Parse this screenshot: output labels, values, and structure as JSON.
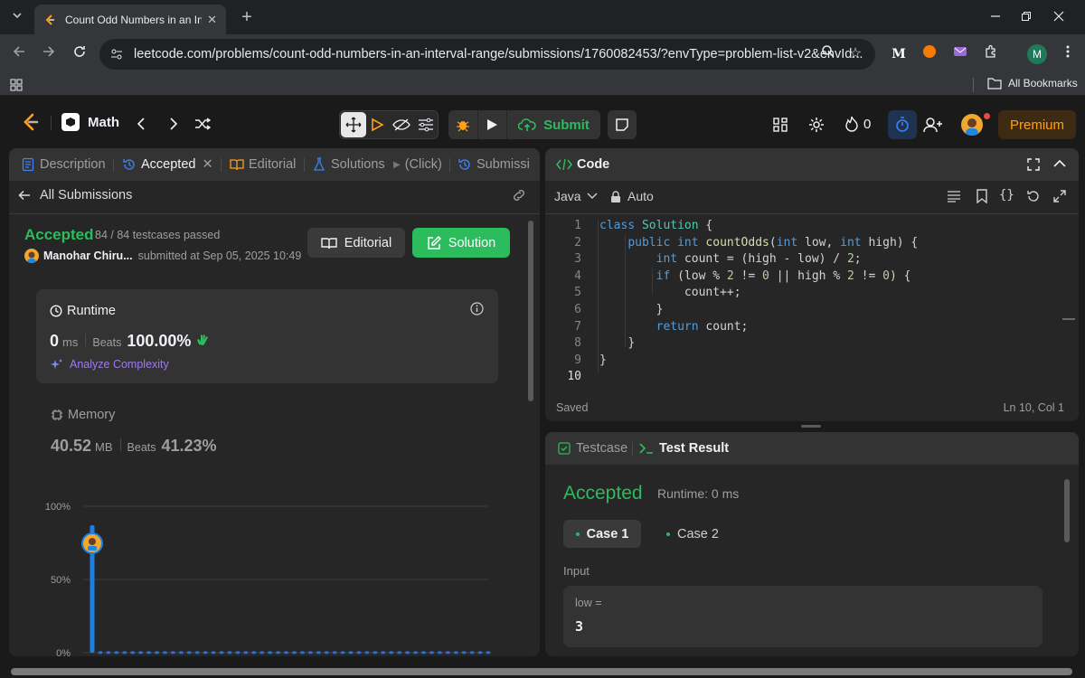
{
  "browser": {
    "tab_title": "Count Odd Numbers in an Inte",
    "url": "leetcode.com/problems/count-odd-numbers-in-an-interval-range/submissions/1760082453/?envType=problem-list-v2&envId...",
    "bookmarks_label": "All Bookmarks",
    "profile_initial": "M"
  },
  "topbar": {
    "problem_list": "Math",
    "submit_label": "Submit",
    "streak_count": "0",
    "premium_label": "Premium"
  },
  "left_tabs": {
    "description": "Description",
    "accepted": "Accepted",
    "editorial": "Editorial",
    "solutions": "Solutions",
    "click": "(Click)",
    "submissions": "Submissi"
  },
  "submission": {
    "back_label": "All Submissions",
    "status": "Accepted",
    "testcases": "84 / 84 testcases passed",
    "user": "Manohar Chiru...",
    "submitted_at": "submitted at Sep 05, 2025 10:49",
    "editorial_btn": "Editorial",
    "solution_btn": "Solution",
    "runtime_title": "Runtime",
    "runtime_value": "0",
    "runtime_unit": "ms",
    "beats_label": "Beats",
    "runtime_beats": "100.00%",
    "analyze_label": "Analyze Complexity",
    "memory_title": "Memory",
    "memory_value": "40.52",
    "memory_unit": "MB",
    "memory_beats": "41.23%"
  },
  "chart_data": {
    "type": "bar",
    "yticks": [
      "100%",
      "50%",
      "0%"
    ],
    "ylim": [
      0,
      100
    ],
    "values": [
      87,
      1,
      1,
      1,
      1,
      1,
      1,
      1,
      1,
      1,
      1,
      1,
      1,
      1,
      1,
      1,
      1,
      1,
      1,
      1,
      1,
      1,
      1,
      1,
      1,
      1,
      1,
      1,
      1,
      1,
      1,
      1,
      1,
      1,
      1,
      1,
      1,
      1,
      1,
      1,
      1,
      1,
      1,
      1,
      1,
      1,
      1,
      1,
      1,
      1
    ],
    "highlight_index": 0
  },
  "code_panel": {
    "title": "Code",
    "language": "Java",
    "mode": "Auto",
    "saved": "Saved",
    "cursor": "Ln 10, Col 1",
    "lines": [
      "1",
      "2",
      "3",
      "4",
      "5",
      "6",
      "7",
      "8",
      "9",
      "10"
    ],
    "code": {
      "l1a": "class",
      "l1b": "Solution",
      "l1c": " {",
      "l2a": "public int",
      "l2b": "countOdds",
      "l2c": "(",
      "l2d": "int",
      "l2e": " low, ",
      "l2f": "int",
      "l2g": " high) {",
      "l3a": "int",
      "l3b": " count = (high - low) / ",
      "l3c": "2",
      "l3d": ";",
      "l4a": "if",
      "l4b": " (low % ",
      "l4c": "2",
      "l4d": " != ",
      "l4e": "0",
      "l4f": " || high % ",
      "l4g": "2",
      "l4h": " != ",
      "l4i": "0",
      "l4j": ") {",
      "l5": "count++;",
      "l6": "}",
      "l7a": "return",
      "l7b": " count;",
      "l8": "}",
      "l9": "}"
    }
  },
  "test_panel": {
    "testcase_tab": "Testcase",
    "result_tab": "Test Result",
    "status": "Accepted",
    "runtime": "Runtime: 0 ms",
    "case1": "Case 1",
    "case2": "Case 2",
    "input_label": "Input",
    "var_name": "low =",
    "var_value": "3"
  },
  "colors": {
    "accent_green": "#2cbb5d",
    "blue": "#3b82f6",
    "premium": "#ffa116"
  }
}
